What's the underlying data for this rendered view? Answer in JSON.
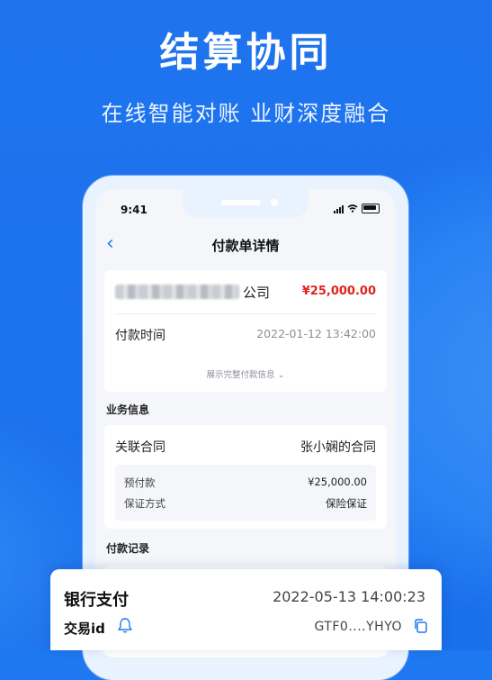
{
  "hero": {
    "title": "结算协同",
    "subtitle": "在线智能对账 业财深度融合"
  },
  "status_bar": {
    "time": "9:41"
  },
  "nav": {
    "title": "付款单详情"
  },
  "payment": {
    "company_suffix": "公司",
    "amount": "¥25,000.00",
    "time_label": "付款时间",
    "time_value": "2022-01-12 13:42:00",
    "expand_label": "展示完整付款信息"
  },
  "business": {
    "section_title": "业务信息",
    "contract_label": "关联合同",
    "contract_value": "张小娴的合同",
    "rows": [
      {
        "label": "预付款",
        "value": "¥25,000.00"
      },
      {
        "label": "保证方式",
        "value": "保险保证"
      }
    ]
  },
  "records": {
    "section_title": "付款记录"
  },
  "bottom_card": {
    "method": "银行支付",
    "time": "2022-05-13 14:00:23",
    "txid_label": "交易id",
    "txid_value": "GTF0....YHYO"
  },
  "colors": {
    "brand_blue": "#1E78F0",
    "amount_red": "#E2231A"
  },
  "icons": [
    "back-icon",
    "signal-icon",
    "wifi-icon",
    "battery-icon",
    "chevron-down-icon",
    "bell-icon",
    "copy-icon"
  ]
}
